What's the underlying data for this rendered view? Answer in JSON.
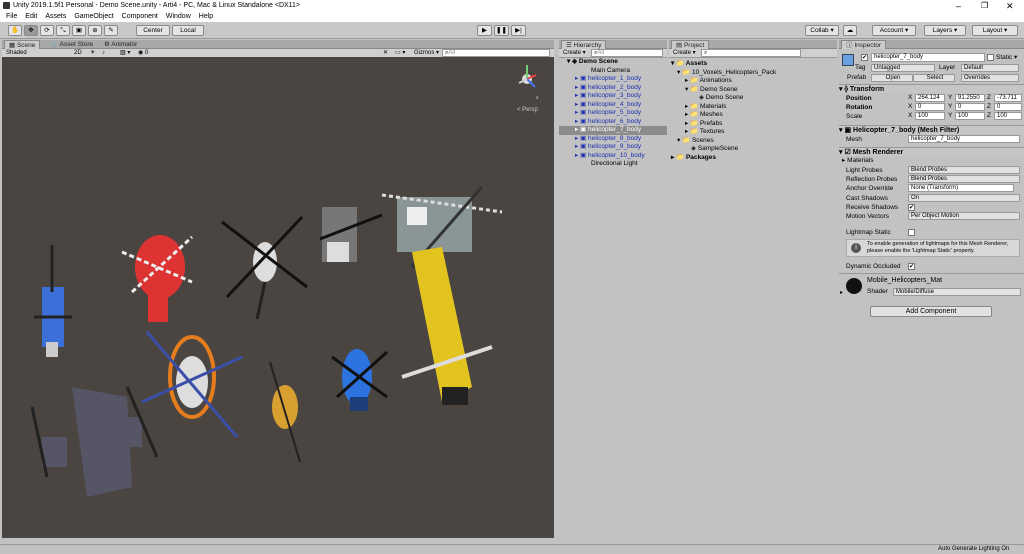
{
  "window": {
    "title": "Unity 2019.1.5f1 Personal - Demo Scene.unity - Arti4 - PC, Mac & Linux Standalone <DX11>"
  },
  "menu": [
    "File",
    "Edit",
    "Assets",
    "GameObject",
    "Component",
    "Window",
    "Help"
  ],
  "toolbar": {
    "center": "Center",
    "local": "Local",
    "collab": "Collab ▾",
    "account": "Account ▾",
    "layers": "Layers ▾",
    "layout": "Layout ▾"
  },
  "scene": {
    "tabs": [
      "Scene",
      "Asset Store",
      "Animator"
    ],
    "shading": "Shaded",
    "mode2d": "2D",
    "gizmos": "Gizmos ▾",
    "search_placeholder": "All",
    "persp": "< Persp",
    "fx": "0"
  },
  "hierarchy": {
    "tab": "Hierarchy",
    "create": "Create ▾",
    "search_placeholder": "All",
    "scene_name": "Demo Scene",
    "items": [
      "Main Camera",
      "helicopter_1_body",
      "helicopter_2_body",
      "helicopter_3_body",
      "helicopter_4_body",
      "helicopter_5_body",
      "helicopter_6_body",
      "helicopter_7_body",
      "helicopter_8_body",
      "helicopter_9_body",
      "helicopter_10_body",
      "Directional Light"
    ]
  },
  "project": {
    "tab": "Project",
    "create": "Create ▾",
    "items": [
      "Assets",
      "10_Voxels_Helicopters_Pack",
      "Animations",
      "Demo Scene",
      "Demo Scene",
      "Materials",
      "Meshes",
      "Prefabs",
      "Textures",
      "Scenes",
      "SampleScene",
      "Packages"
    ]
  },
  "inspector": {
    "tab": "Inspector",
    "name": "helicopter_7_body",
    "static": "Static ▾",
    "tag_label": "Tag",
    "tag": "Untagged",
    "layer_label": "Layer",
    "layer": "Default",
    "prefab_label": "Prefab",
    "open": "Open",
    "select": "Select",
    "overrides": "Overrides",
    "transform": {
      "title": "Transform",
      "position_label": "Position",
      "rotation_label": "Rotation",
      "scale_label": "Scale",
      "position": [
        "264.124",
        "91.2550",
        "-73.711"
      ],
      "rotation": [
        "0",
        "0",
        "0"
      ],
      "scale": [
        "100",
        "100",
        "100"
      ]
    },
    "mesh_filter": {
      "title": "Helicopter_7_body (Mesh Filter)",
      "mesh_label": "Mesh",
      "mesh": "helicopter_7_body"
    },
    "mesh_renderer": {
      "title": "Mesh Renderer",
      "materials_label": "Materials",
      "light_probes_label": "Light Probes",
      "light_probes": "Blend Probes",
      "reflection_probes_label": "Reflection Probes",
      "reflection_probes": "Blend Probes",
      "anchor_override_label": "Anchor Override",
      "anchor_override": "None (Transform)",
      "cast_shadows_label": "Cast Shadows",
      "cast_shadows": "On",
      "receive_shadows_label": "Receive Shadows",
      "motion_vectors_label": "Motion Vectors",
      "motion_vectors": "Per Object Motion",
      "lightmap_static_label": "Lightmap Static",
      "info": "To enable generation of lightmaps for this Mesh Renderer, please enable the 'Lightmap Static' property.",
      "dynamic_occluded_label": "Dynamic Occluded"
    },
    "material": {
      "name": "Mobile_Helicopters_Mat",
      "shader_label": "Shader",
      "shader": "Mobile/Diffuse"
    },
    "add_component": "Add Component"
  },
  "status": {
    "text": "Auto Generate Lighting On"
  },
  "colors": {
    "scene_bg": "#4a4541",
    "selection": "#8c8c8c",
    "link_blue": "#1a2fb0"
  }
}
